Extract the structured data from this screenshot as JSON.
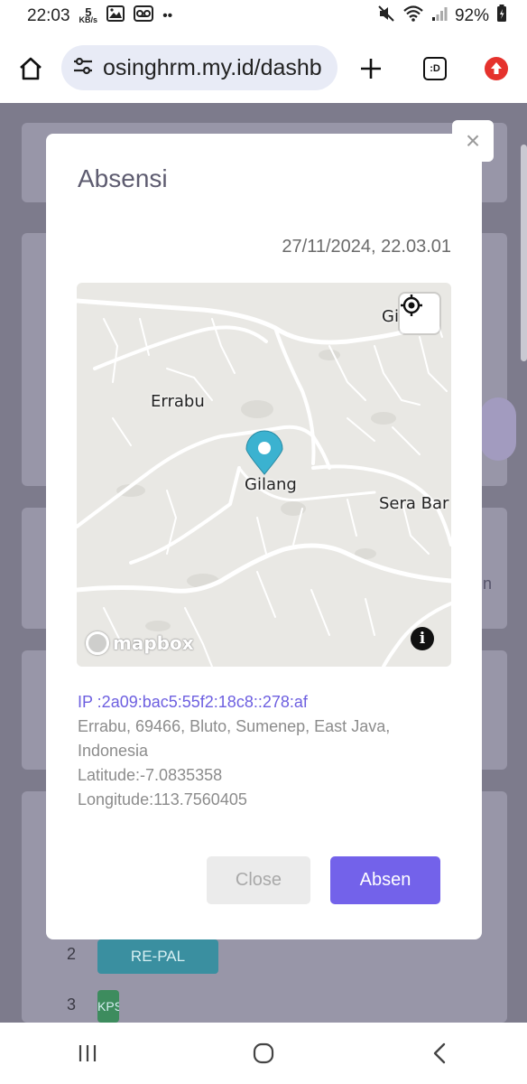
{
  "status_bar": {
    "time": "22:03",
    "kbs_value": "5",
    "kbs_unit": "KB/s",
    "more": "••",
    "battery": "92%"
  },
  "browser": {
    "url": "osinghrm.my.id/dashb",
    "tab_count": ":D"
  },
  "background": {
    "rows": [
      {
        "num": "2",
        "tag": "RE-PAL"
      },
      {
        "num": "3",
        "tag": "KPS"
      }
    ],
    "side_letter": "n"
  },
  "modal": {
    "title": "Absensi",
    "datetime": "27/11/2024, 22.03.01",
    "map": {
      "labels": {
        "errabu": "Errabu",
        "gilang": "Gilang",
        "sera": "Sera Bar",
        "top_right": "Gi    in"
      },
      "logo": "mapbox",
      "info": "i"
    },
    "ip": "IP :2a09:bac5:55f2:18c8::278:af",
    "address": "Errabu, 69466, Bluto, Sumenep, East Java, Indonesia",
    "latitude": "Latitude:-7.0835358",
    "longitude": "Longitude:113.7560405",
    "close_label": "Close",
    "absen_label": "Absen",
    "x_label": "×"
  },
  "colors": {
    "primary": "#7362ea",
    "ip_text": "#6d5fe0",
    "overlay": "#7d7b8c",
    "map_bg": "#e9e8e4",
    "pin": "#3bb2d0"
  }
}
